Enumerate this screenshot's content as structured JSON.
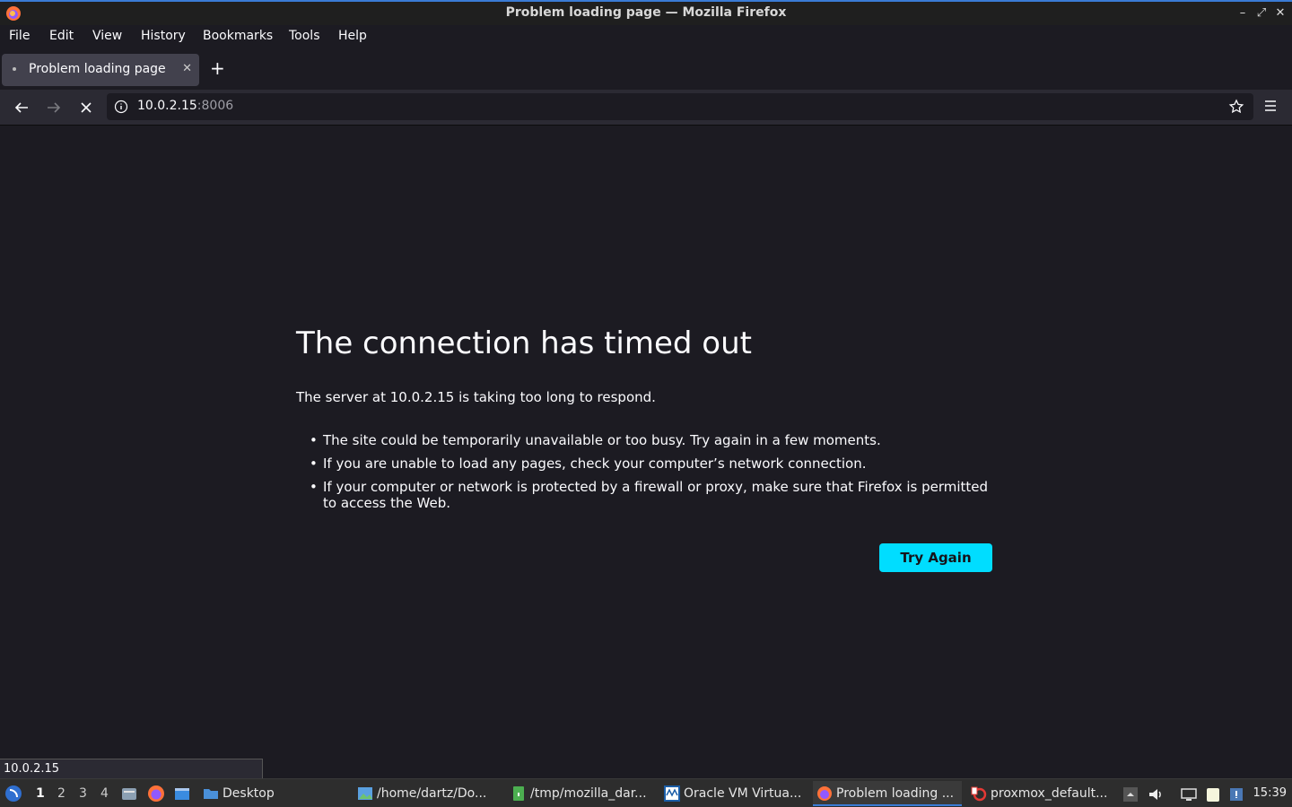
{
  "window": {
    "title": "Problem loading page — Mozilla Firefox"
  },
  "menubar": {
    "items": [
      "File",
      "Edit",
      "View",
      "History",
      "Bookmarks",
      "Tools",
      "Help"
    ]
  },
  "tab": {
    "label": "Problem loading page"
  },
  "urlbar": {
    "host": "10.0.2.15",
    "port": ":8006"
  },
  "error": {
    "title": "The connection has timed out",
    "description": "The server at 10.0.2.15 is taking too long to respond.",
    "bullets": [
      "The site could be temporarily unavailable or too busy. Try again in a few moments.",
      "If you are unable to load any pages, check your computer’s network connection.",
      "If your computer or network is protected by a firewall or proxy, make sure that Firefox is permitted to access the Web."
    ],
    "button": "Try Again"
  },
  "status": {
    "text": "10.0.2.15"
  },
  "taskbar": {
    "workspaces": [
      "1",
      "2",
      "3",
      "4"
    ],
    "tasks": [
      {
        "label": "Desktop",
        "icon": "folder-icon"
      },
      {
        "label": "/home/dartz/Do...",
        "icon": "image-viewer-icon"
      },
      {
        "label": "/tmp/mozilla_dar...",
        "icon": "archive-icon"
      },
      {
        "label": "Oracle VM Virtua...",
        "icon": "virtualbox-icon"
      },
      {
        "label": "Problem loading ...",
        "icon": "firefox-icon"
      },
      {
        "label": "proxmox_default...",
        "icon": "document-viewer-icon"
      }
    ],
    "clock": "15:39"
  },
  "colors": {
    "accent": "#00ddff",
    "page_bg": "#1c1b22",
    "toolbar_bg": "#2b2a33"
  }
}
